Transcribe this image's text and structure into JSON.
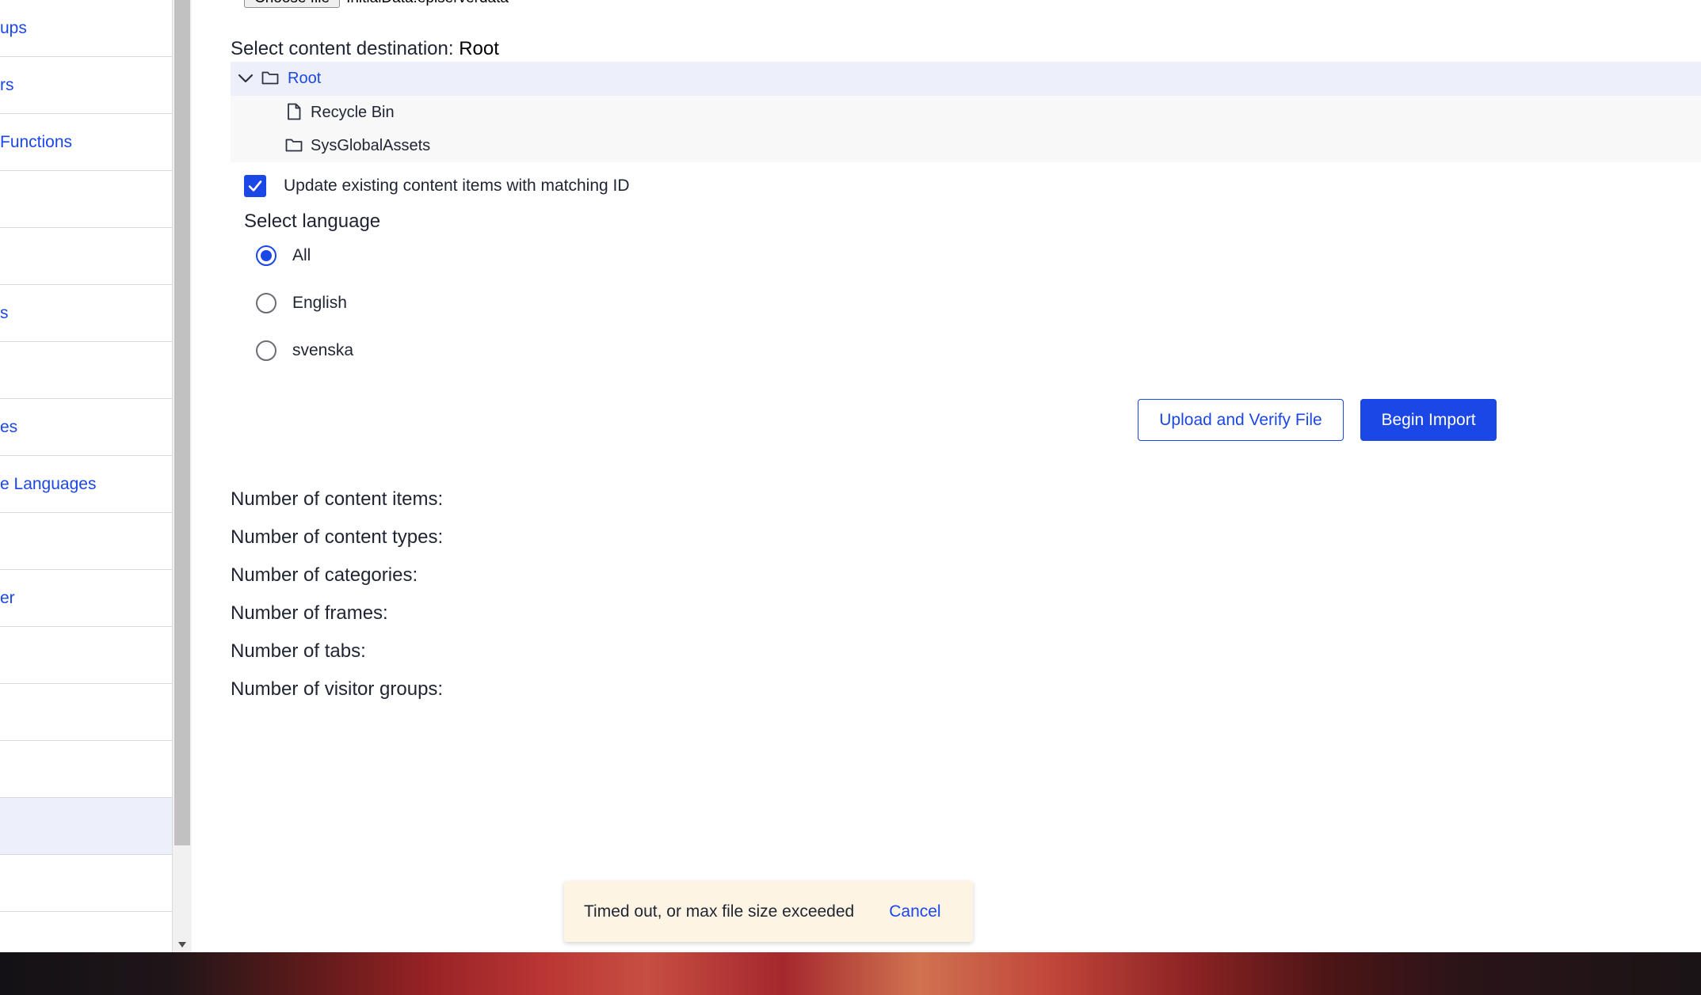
{
  "sidebar": {
    "items": [
      {
        "label": "ups"
      },
      {
        "label": "rs"
      },
      {
        "label": " Functions"
      },
      {
        "label": ""
      },
      {
        "label": ""
      },
      {
        "label": "s"
      },
      {
        "label": ""
      },
      {
        "label": "es"
      },
      {
        "label": "e Languages"
      },
      {
        "label": ""
      },
      {
        "label": "er"
      },
      {
        "label": ""
      },
      {
        "label": ""
      },
      {
        "label": ""
      },
      {
        "label": ""
      },
      {
        "label": ""
      }
    ]
  },
  "file": {
    "button_label": "Choose file",
    "file_name": "InitialData.episerverdata"
  },
  "destination": {
    "label": "Select content destination:",
    "value": "Root"
  },
  "tree": {
    "root": {
      "label": "Root",
      "icon": "folder-icon"
    },
    "children": [
      {
        "label": "Recycle Bin",
        "icon": "file-icon"
      },
      {
        "label": "SysGlobalAssets",
        "icon": "folder-icon"
      }
    ]
  },
  "update_existing": {
    "label": "Update existing content items with matching ID",
    "checked": true
  },
  "language": {
    "title": "Select language",
    "options": [
      {
        "label": "All",
        "checked": true
      },
      {
        "label": "English",
        "checked": false
      },
      {
        "label": "svenska",
        "checked": false
      }
    ]
  },
  "actions": {
    "upload_label": "Upload and Verify File",
    "import_label": "Begin Import"
  },
  "stats": [
    "Number of content items:",
    "Number of content types:",
    "Number of categories:",
    "Number of frames:",
    "Number of tabs:",
    "Number of visitor groups:"
  ],
  "toast": {
    "message": "Timed out, or max file size exceeded",
    "cancel_label": "Cancel"
  },
  "colors": {
    "accent": "#1a47e6",
    "toast_bg": "#fdf4e3",
    "selected_row": "#edf0fb"
  }
}
